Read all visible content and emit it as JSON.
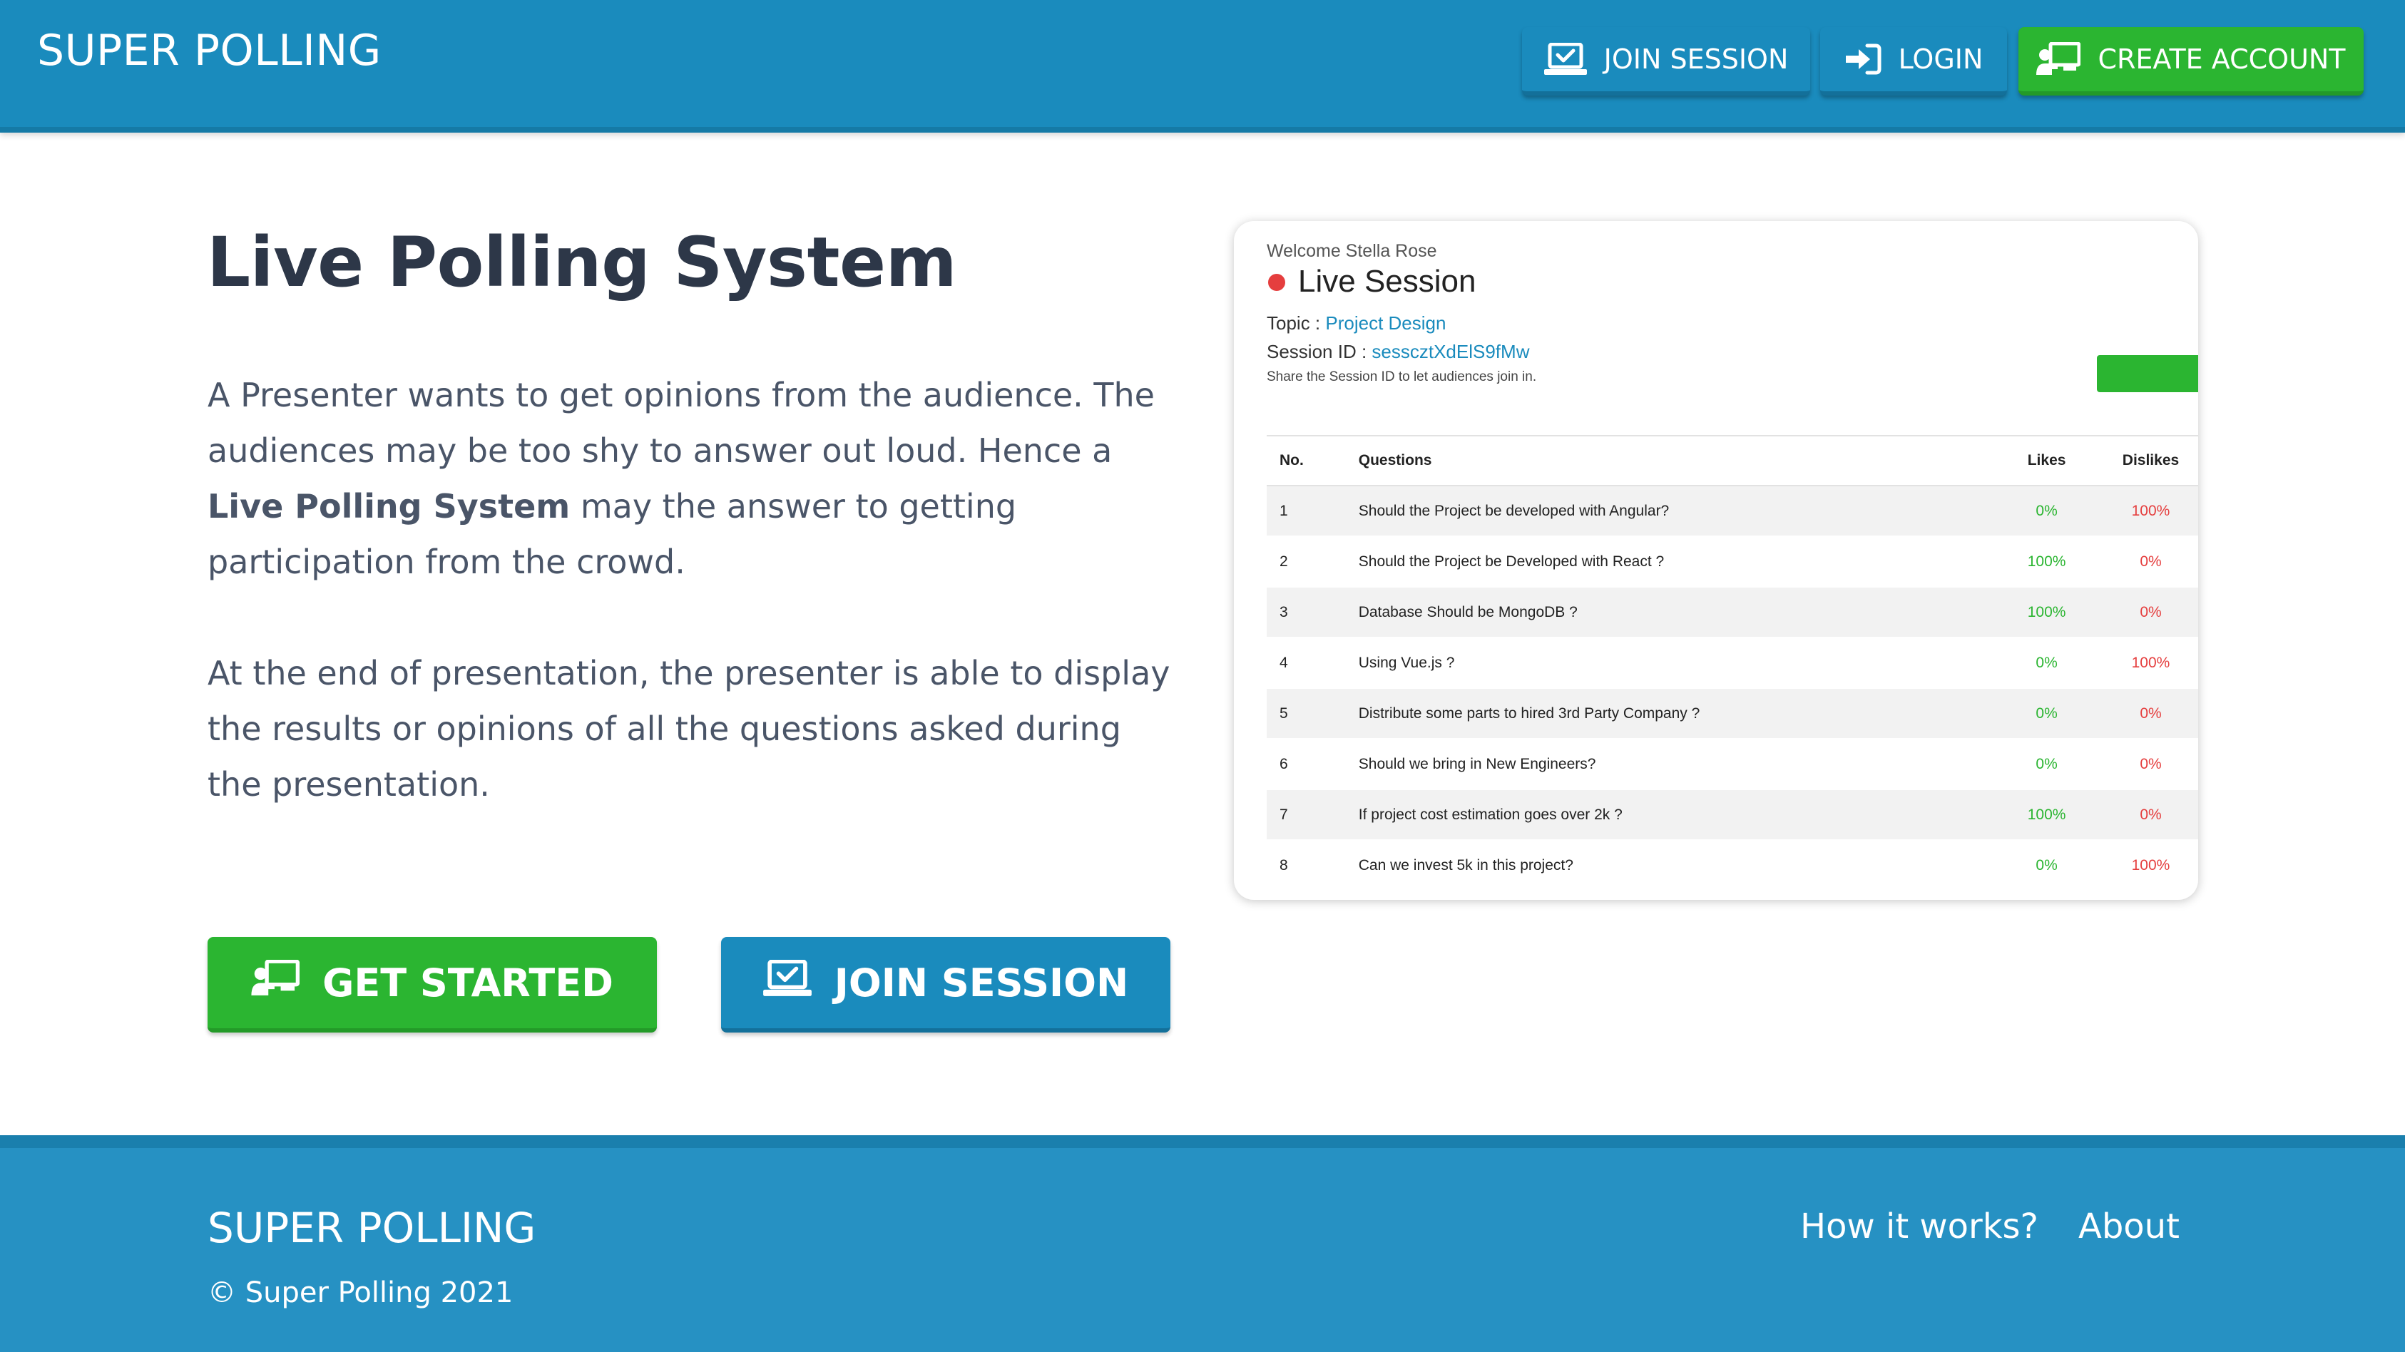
{
  "header": {
    "brand": "SUPER POLLING",
    "nav": {
      "join_label": "JOIN SESSION",
      "login_label": "LOGIN",
      "create_label": "CREATE ACCOUNT"
    }
  },
  "hero": {
    "title": "Live Polling System",
    "para1_part1": "A Presenter wants to get opinions from the audience. The audiences may be too shy to answer out loud. Hence a ",
    "para1_bold": "Live Polling System",
    "para1_part2": " may the answer to getting participation from the crowd.",
    "para2": "At the end of presentation, the presenter is able to display the results or opinions of all the questions asked during the presentation.",
    "get_started_label": "GET STARTED",
    "join_session_label": "JOIN SESSION"
  },
  "preview": {
    "welcome": "Welcome Stella Rose",
    "live_label": "Live Session",
    "topic_label": "Topic :",
    "topic_value": "Project Design",
    "session_label": "Session ID :",
    "session_value": "sesscztXdElS9fMw",
    "share_note": "Share the Session ID to let audiences join in.",
    "table": {
      "headers": [
        "No.",
        "Questions",
        "Likes",
        "Dislikes"
      ],
      "rows": [
        {
          "no": "1",
          "q": "Should the Project be developed with Angular?",
          "likes": "0%",
          "dislikes": "100%",
          "likes_color": "green",
          "dislikes_color": "red"
        },
        {
          "no": "2",
          "q": "Should the Project be Developed with React ?",
          "likes": "100%",
          "dislikes": "0%",
          "likes_color": "green",
          "dislikes_color": "red"
        },
        {
          "no": "3",
          "q": "Database Should be MongoDB ?",
          "likes": "100%",
          "dislikes": "0%",
          "likes_color": "green",
          "dislikes_color": "red"
        },
        {
          "no": "4",
          "q": "Using Vue.js ?",
          "likes": "0%",
          "dislikes": "100%",
          "likes_color": "green",
          "dislikes_color": "red"
        },
        {
          "no": "5",
          "q": "Distribute some parts to hired 3rd Party Company ?",
          "likes": "0%",
          "dislikes": "0%",
          "likes_color": "green",
          "dislikes_color": "red"
        },
        {
          "no": "6",
          "q": "Should we bring in New Engineers?",
          "likes": "0%",
          "dislikes": "0%",
          "likes_color": "green",
          "dislikes_color": "red"
        },
        {
          "no": "7",
          "q": "If project cost estimation goes over 2k ?",
          "likes": "100%",
          "dislikes": "0%",
          "likes_color": "green",
          "dislikes_color": "red"
        },
        {
          "no": "8",
          "q": "Can we invest 5k in this project?",
          "likes": "0%",
          "dislikes": "100%",
          "likes_color": "green",
          "dislikes_color": "red"
        }
      ]
    }
  },
  "footer": {
    "brand": "SUPER POLLING",
    "copyright": "© Super Polling 2021",
    "link_how": "How it works?",
    "link_about": "About"
  },
  "colors": {
    "primary": "#1a8bbd",
    "success": "#2bb531",
    "danger": "#e53e3e",
    "footer_bg": "#2691c3"
  },
  "icons": {
    "join": "laptop-check-icon",
    "login": "sign-in-icon",
    "create": "presenter-board-icon"
  }
}
